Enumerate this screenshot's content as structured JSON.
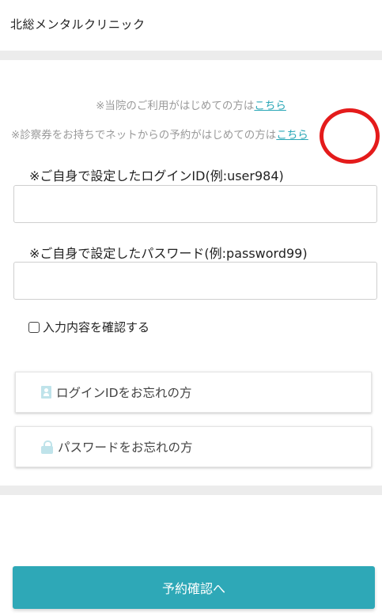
{
  "header": {
    "clinic_name": "北総メンタルクリニック"
  },
  "notices": {
    "first_visit_text": "※当院のご利用がはじめての方は",
    "first_visit_link": "こちら",
    "online_first_text": "※診察券をお持ちでネットからの予約がはじめての方は",
    "online_first_link": "こちら"
  },
  "login": {
    "id_label": "※ご自身で設定したログインID(例:user984)",
    "id_value": "",
    "password_label": "※ご自身で設定したパスワード(例:password99)",
    "password_value": ""
  },
  "confirm": {
    "label": "入力内容を確認する",
    "checked": false
  },
  "forgot": {
    "id_label": "ログインIDをお忘れの方",
    "id_icon": "id-card-icon",
    "password_label": "パスワードをお忘れの方",
    "password_icon": "lock-icon"
  },
  "submit": {
    "label": "予約確認へ"
  },
  "colors": {
    "accent": "#2ea8b7",
    "link": "#2aa7b7",
    "annotation": "#e41b1b"
  }
}
